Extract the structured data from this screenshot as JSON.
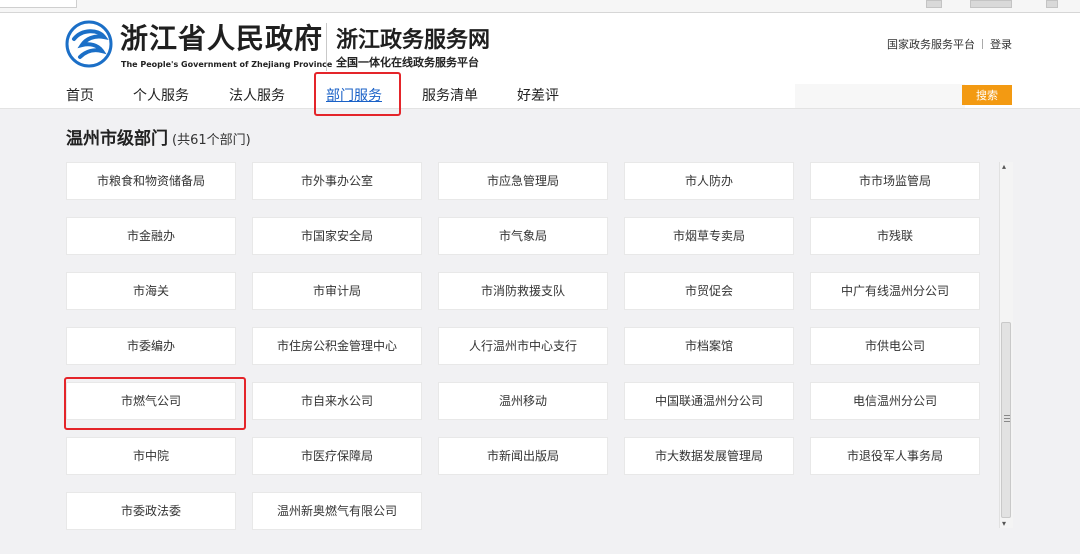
{
  "header": {
    "gov_title": "浙江省人民政府",
    "gov_subtitle": "The People's Government of Zhejiang Province",
    "portal_title": "浙江政务服务网",
    "portal_subtitle": "全国一体化在线政务服务平台",
    "links": [
      "国家政务服务平台",
      "登录"
    ],
    "logo_icon": "zhejiang-emblem-icon"
  },
  "nav": {
    "items": [
      "首页",
      "个人服务",
      "法人服务",
      "部门服务",
      "服务清单",
      "好差评"
    ],
    "active": "部门服务",
    "search_placeholder": "",
    "search_button": "搜索"
  },
  "section": {
    "title": "温州市级部门",
    "count": "(共61个部门)"
  },
  "departments": [
    "市粮食和物资储备局",
    "市外事办公室",
    "市应急管理局",
    "市人防办",
    "市市场监管局",
    "市金融办",
    "市国家安全局",
    "市气象局",
    "市烟草专卖局",
    "市残联",
    "市海关",
    "市审计局",
    "市消防救援支队",
    "市贸促会",
    "中广有线温州分公司",
    "市委编办",
    "市住房公积金管理中心",
    "人行温州市中心支行",
    "市档案馆",
    "市供电公司",
    "市燃气公司",
    "市自来水公司",
    "温州移动",
    "中国联通温州分公司",
    "电信温州分公司",
    "市中院",
    "市医疗保障局",
    "市新闻出版局",
    "市大数据发展管理局",
    "市退役军人事务局",
    "市委政法委",
    "温州新奥燃气有限公司"
  ],
  "scrollbar": {
    "up_glyph": "▴",
    "down_glyph": "▾"
  },
  "colors": {
    "accent": "#f39a12",
    "highlight": "#e4252a",
    "active_nav": "#1a61c7",
    "logo_blue": "#1b6fc7"
  }
}
